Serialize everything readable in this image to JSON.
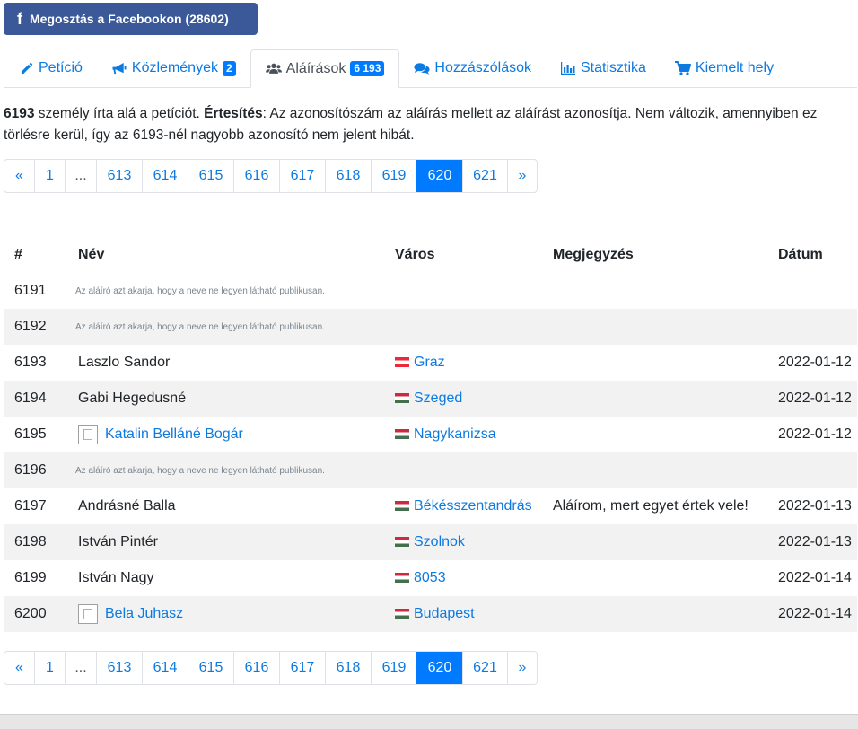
{
  "facebook_button": {
    "icon": "f",
    "label": "Megosztás a Facebookon (28602)"
  },
  "tabs": [
    {
      "icon": "pencil-icon",
      "label": "Petíció",
      "badge": ""
    },
    {
      "icon": "megaphone-icon",
      "label": "Közlemények",
      "badge": "2"
    },
    {
      "icon": "users-icon",
      "label": "Aláírások",
      "badge": "6 193"
    },
    {
      "icon": "comments-icon",
      "label": "Hozzászólások",
      "badge": ""
    },
    {
      "icon": "bar-chart-icon",
      "label": "Statisztika",
      "badge": ""
    },
    {
      "icon": "cart-icon",
      "label": "Kiemelt hely",
      "badge": ""
    }
  ],
  "intro": {
    "count": "6193",
    "text1": " személy írta alá a petíciót. ",
    "notice_label": "Értesítés",
    "text2": ": Az azonosítószám az aláírás mellett az aláírást azonosítja. Nem változik, amennyiben ez törlésre kerül, így az 6193-nél nagyobb azonosító nem jelent hibát."
  },
  "pagination": {
    "prev": "«",
    "first": "1",
    "ellipsis": "...",
    "pages": [
      "613",
      "614",
      "615",
      "616",
      "617",
      "618",
      "619",
      "620",
      "621"
    ],
    "active": "620",
    "next": "»"
  },
  "table": {
    "headers": {
      "num": "#",
      "name": "Név",
      "city": "Város",
      "note": "Megjegyzés",
      "date": "Dátum"
    },
    "hidden_text": "Az aláíró azt akarja, hogy a neve ne legyen látható publikusan.",
    "rows": [
      {
        "num": "6191",
        "hidden": true
      },
      {
        "num": "6192",
        "hidden": true
      },
      {
        "num": "6193",
        "name": "Laszlo Sandor",
        "name_link": false,
        "avatar": false,
        "flag": "at",
        "city": "Graz",
        "note": "",
        "date": "2022-01-12"
      },
      {
        "num": "6194",
        "name": "Gabi Hegedusné",
        "name_link": false,
        "avatar": false,
        "flag": "hu",
        "city": "Szeged",
        "note": "",
        "date": "2022-01-12"
      },
      {
        "num": "6195",
        "name": "Katalin Belláné Bogár",
        "name_link": true,
        "avatar": true,
        "flag": "hu",
        "city": "Nagykanizsa",
        "note": "",
        "date": "2022-01-12"
      },
      {
        "num": "6196",
        "hidden": true
      },
      {
        "num": "6197",
        "name": "Andrásné Balla",
        "name_link": false,
        "avatar": false,
        "flag": "hu",
        "city": "Békésszentandrás",
        "note": "Aláírom, mert egyet értek vele!",
        "date": "2022-01-13"
      },
      {
        "num": "6198",
        "name": "István Pintér",
        "name_link": false,
        "avatar": false,
        "flag": "hu",
        "city": "Szolnok",
        "note": "",
        "date": "2022-01-13"
      },
      {
        "num": "6199",
        "name": "István Nagy",
        "name_link": false,
        "avatar": false,
        "flag": "hu",
        "city": "8053",
        "note": "",
        "date": "2022-01-14"
      },
      {
        "num": "6200",
        "name": "Bela Juhasz",
        "name_link": true,
        "avatar": true,
        "flag": "hu",
        "city": "Budapest",
        "note": "",
        "date": "2022-01-14"
      }
    ]
  },
  "colors": {
    "link": "#0d7ae0",
    "primary": "#007bff",
    "facebook": "#3b5998",
    "stripe": "#f2f2f2"
  }
}
